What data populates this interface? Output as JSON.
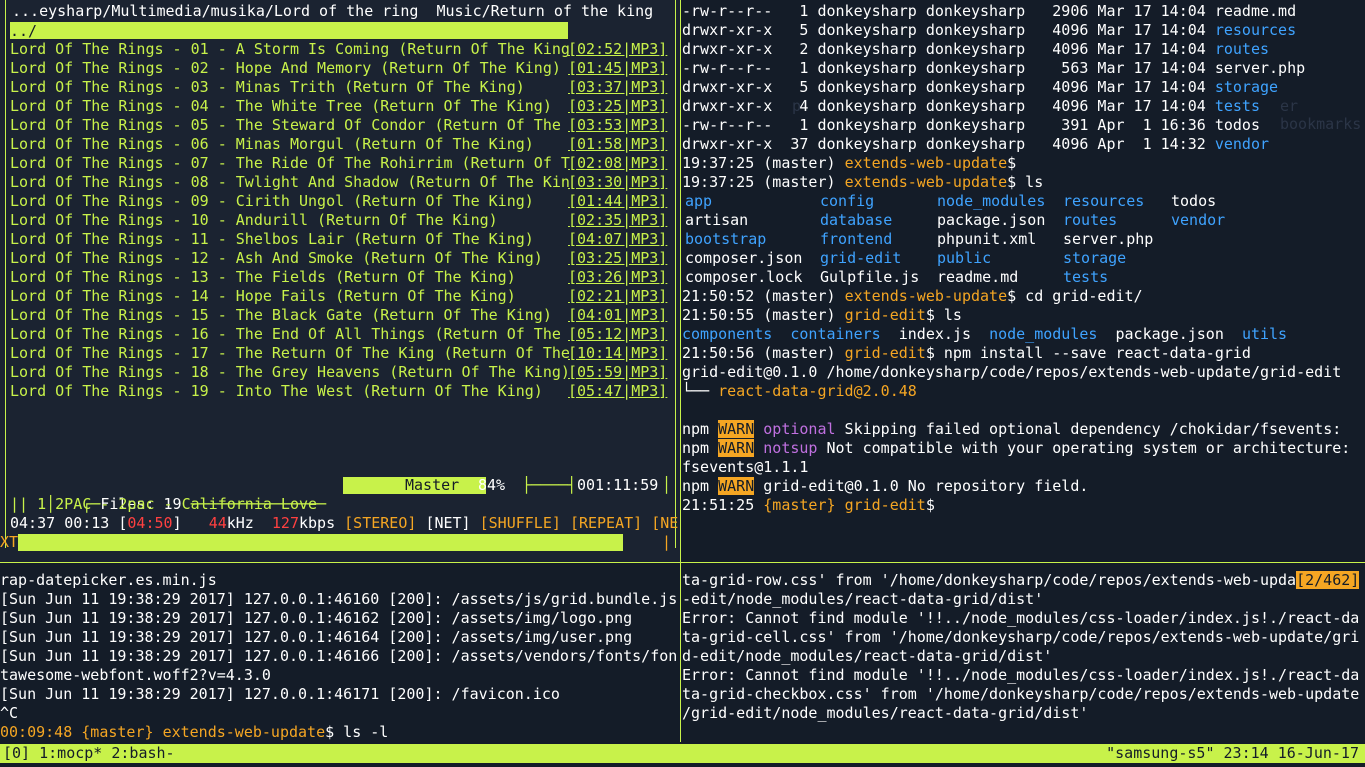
{
  "mocp": {
    "path": "...eysharp/Multimedia/musika/Lord of the ring  Music/Return of the king",
    "selected": "../",
    "tracks": [
      {
        "title": "Lord Of The Rings - 01 - A Storm Is Coming (Return Of The King",
        "time": "[02:52|MP3]"
      },
      {
        "title": "Lord Of The Rings - 02 - Hope And Memory (Return Of The King)",
        "time": "[01:45|MP3]"
      },
      {
        "title": "Lord Of The Rings - 03 - Minas Trith (Return Of The King)",
        "time": "[03:37|MP3]"
      },
      {
        "title": "Lord Of The Rings - 04 - The White Tree (Return Of The King)",
        "time": "[03:25|MP3]"
      },
      {
        "title": "Lord Of The Rings - 05 - The Steward Of Condor (Return Of The",
        "time": "[03:53|MP3]"
      },
      {
        "title": "Lord Of The Rings - 06 - Minas Morgul (Return Of The King)",
        "time": "[01:58|MP3]"
      },
      {
        "title": "Lord Of The Rings - 07 - The Ride Of The Rohirrim (Return Of T",
        "time": "[02:08|MP3]"
      },
      {
        "title": "Lord Of The Rings - 08 - Twlight And Shadow (Return Of The Kin",
        "time": "[03:30|MP3]"
      },
      {
        "title": "Lord Of The Rings - 09 - Cirith Ungol (Return Of The King)",
        "time": "[01:44|MP3]"
      },
      {
        "title": "Lord Of The Rings - 10 - Andurill (Return Of The King)",
        "time": "[02:35|MP3]"
      },
      {
        "title": "Lord Of The Rings - 11 - Shelbos Lair (Return Of The King)",
        "time": "[04:07|MP3]"
      },
      {
        "title": "Lord Of The Rings - 12 - Ash And Smoke (Return Of The King)",
        "time": "[03:25|MP3]"
      },
      {
        "title": "Lord Of The Rings - 13 - The Fields (Return Of The King)",
        "time": "[03:26|MP3]"
      },
      {
        "title": "Lord Of The Rings - 14 - Hope Fails (Return Of The King)",
        "time": "[02:21|MP3]"
      },
      {
        "title": "Lord Of The Rings - 15 - The Black Gate (Return Of The King)",
        "time": "[04:01|MP3]"
      },
      {
        "title": "Lord Of The Rings - 16 - The End Of All Things (Return Of The",
        "time": "[05:12|MP3]"
      },
      {
        "title": "Lord Of The Rings - 17 - The Return Of The King (Return Of The",
        "time": "[10:14|MP3]"
      },
      {
        "title": "Lord Of The Rings - 18 - The Grey Heavens (Return Of The King)",
        "time": "[05:59|MP3]"
      },
      {
        "title": "Lord Of The Rings - 19 - Into The West (Return Of The King)",
        "time": "[05:47|MP3]"
      }
    ],
    "files_label": "Files: 19",
    "mixer_label": "Master",
    "mixer_pct": "84%",
    "total_time": "001:11:59",
    "now_playing": "|| 1 2PAC - 2pac - California Love",
    "elapsed": "04:37",
    "remaining": "00:13",
    "total": "[04:50]",
    "rate": "44",
    "rate_unit": "kHz",
    "bitrate": "127",
    "bitrate_unit": "kbps",
    "flags": "[STEREO]",
    "net": "[NET]",
    "shuffle": "[SHUFFLE]",
    "repeat": "[REPEAT]",
    "next1": "[NE",
    "next2": "XT",
    "progress": 0.93
  },
  "top_right": {
    "listing": [
      {
        "perm": "-rw-r--r--",
        "n": "1",
        "u": "donkeysharp",
        "g": "donkeysharp",
        "size": "2906",
        "date": "Mar 17 14:04",
        "name": "readme.md",
        "dir": false
      },
      {
        "perm": "drwxr-xr-x",
        "n": "5",
        "u": "donkeysharp",
        "g": "donkeysharp",
        "size": "4096",
        "date": "Mar 17 14:04",
        "name": "resources",
        "dir": true
      },
      {
        "perm": "drwxr-xr-x",
        "n": "2",
        "u": "donkeysharp",
        "g": "donkeysharp",
        "size": "4096",
        "date": "Mar 17 14:04",
        "name": "routes",
        "dir": true
      },
      {
        "perm": "-rw-r--r--",
        "n": "1",
        "u": "donkeysharp",
        "g": "donkeysharp",
        "size": "563",
        "date": "Mar 17 14:04",
        "name": "server.php",
        "dir": false
      },
      {
        "perm": "drwxr-xr-x",
        "n": "5",
        "u": "donkeysharp",
        "g": "donkeysharp",
        "size": "4096",
        "date": "Mar 17 14:04",
        "name": "storage",
        "dir": true
      },
      {
        "perm": "drwxr-xr-x",
        "n": "4",
        "u": "donkeysharp",
        "g": "donkeysharp",
        "size": "4096",
        "date": "Mar 17 14:04",
        "name": "tests",
        "dir": true
      },
      {
        "perm": "-rw-r--r--",
        "n": "1",
        "u": "donkeysharp",
        "g": "donkeysharp",
        "size": "391",
        "date": "Apr  1 16:36",
        "name": "todos",
        "dir": false
      },
      {
        "perm": "drwxr-xr-x",
        "n": "37",
        "u": "donkeysharp",
        "g": "donkeysharp",
        "size": "4096",
        "date": "Apr  1 14:32",
        "name": "vendor",
        "dir": true
      }
    ],
    "p1_time": "19:37:25",
    "p1_branch": "(master)",
    "p1_dir": "extends-web-update",
    "p1_cmd": "",
    "p2_time": "19:37:25",
    "p2_branch": "(master)",
    "p2_dir": "extends-web-update",
    "p2_cmd": " ls",
    "ls_grid": [
      [
        {
          "t": "app",
          "d": true
        },
        {
          "t": "config",
          "d": true
        },
        {
          "t": "node_modules",
          "d": true
        },
        {
          "t": "resources",
          "d": true
        },
        {
          "t": "todos",
          "d": false
        }
      ],
      [
        {
          "t": "artisan",
          "d": false
        },
        {
          "t": "database",
          "d": true
        },
        {
          "t": "package.json",
          "d": false
        },
        {
          "t": "routes",
          "d": true
        },
        {
          "t": "vendor",
          "d": true
        }
      ],
      [
        {
          "t": "bootstrap",
          "d": true
        },
        {
          "t": "frontend",
          "d": true
        },
        {
          "t": "phpunit.xml",
          "d": false
        },
        {
          "t": "server.php",
          "d": false
        },
        {
          "t": "",
          "d": false
        }
      ],
      [
        {
          "t": "composer.json",
          "d": false
        },
        {
          "t": "grid-edit",
          "d": true
        },
        {
          "t": "public",
          "d": true
        },
        {
          "t": "storage",
          "d": true
        },
        {
          "t": "",
          "d": false
        }
      ],
      [
        {
          "t": "composer.lock",
          "d": false
        },
        {
          "t": "Gulpfile.js",
          "d": false
        },
        {
          "t": "readme.md",
          "d": false
        },
        {
          "t": "tests",
          "d": true
        },
        {
          "t": "",
          "d": false
        }
      ]
    ],
    "p3_time": "21:50:52",
    "p3_branch": "(master)",
    "p3_dir": "extends-web-update",
    "p3_cmd": " cd grid-edit/",
    "p4_time": "21:50:55",
    "p4_branch": "(master)",
    "p4_dir": "grid-edit",
    "p4_cmd": " ls",
    "ls2": [
      {
        "t": "components",
        "d": true
      },
      {
        "t": "containers",
        "d": true
      },
      {
        "t": "index.js",
        "d": false
      },
      {
        "t": "node_modules",
        "d": true
      },
      {
        "t": "package.json",
        "d": false
      },
      {
        "t": "utils",
        "d": true
      }
    ],
    "p5_time": "21:50:56",
    "p5_branch": "(master)",
    "p5_dir": "grid-edit",
    "p5_cmd": " npm install --save react-data-grid",
    "npm_path": "grid-edit@0.1.0 /home/donkeysharp/code/repos/extends-web-update/grid-edit",
    "npm_tree": "└── ",
    "npm_pkg": "react-data-grid@2.0.48",
    "warn1_label": "WARN",
    "warn1_kind": "optional",
    "warn1_msg": " Skipping failed optional dependency /chokidar/fsevents:",
    "warn2_label": "WARN",
    "warn2_kind": "notsup",
    "warn2_msg": " Not compatible with your operating system or architecture:",
    "warn2_cont": "fsevents@1.1.1",
    "warn3_label": "WARN",
    "warn3_msg": " grid-edit@0.1.0 No repository field.",
    "npm": "npm",
    "p6_time": "21:51:25",
    "p6_branch": "{master}",
    "p6_dir": "grid-edit"
  },
  "bottom_left": {
    "lines": [
      "rap-datepicker.es.min.js",
      "[Sun Jun 11 19:38:29 2017] 127.0.0.1:46160 [200]: /assets/js/grid.bundle.js",
      "[Sun Jun 11 19:38:29 2017] 127.0.0.1:46162 [200]: /assets/img/logo.png",
      "[Sun Jun 11 19:38:29 2017] 127.0.0.1:46164 [200]: /assets/img/user.png",
      "[Sun Jun 11 19:38:29 2017] 127.0.0.1:46166 [200]: /assets/vendors/fonts/fon",
      "tawesome-webfont.woff2?v=4.3.0",
      "[Sun Jun 11 19:38:29 2017] 127.0.0.1:46171 [200]: /favicon.ico",
      "^C"
    ],
    "prompt_time": "00:09:48",
    "prompt_branch": "{master}",
    "prompt_dir": "extends-web-update",
    "prompt_cmd": " ls -l"
  },
  "bottom_right": {
    "badge": "[2/462]",
    "first_line": "ta-grid-row.css' from '/home/donkeysharp/code/repos/extends-web-upda",
    "lines": [
      "-edit/node_modules/react-data-grid/dist'",
      "Error: Cannot find module '!!../node_modules/css-loader/index.js!./react-da",
      "ta-grid-cell.css' from '/home/donkeysharp/code/repos/extends-web-update/gri",
      "d-edit/node_modules/react-data-grid/dist'",
      "Error: Cannot find module '!!../node_modules/css-loader/index.js!./react-da",
      "ta-grid-checkbox.css' from '/home/donkeysharp/code/repos/extends-web-update",
      "/grid-edit/node_modules/react-data-grid/dist'"
    ]
  },
  "tmux": {
    "windows": "[0] 1:mocp* 2:bash-",
    "host": "\"samsung-s5\" 23:14 16-Jun-17"
  },
  "colors": {
    "accent": "#c8f24a",
    "orange": "#f5a623",
    "blue": "#3fa3ff",
    "bg": "#141c28"
  }
}
